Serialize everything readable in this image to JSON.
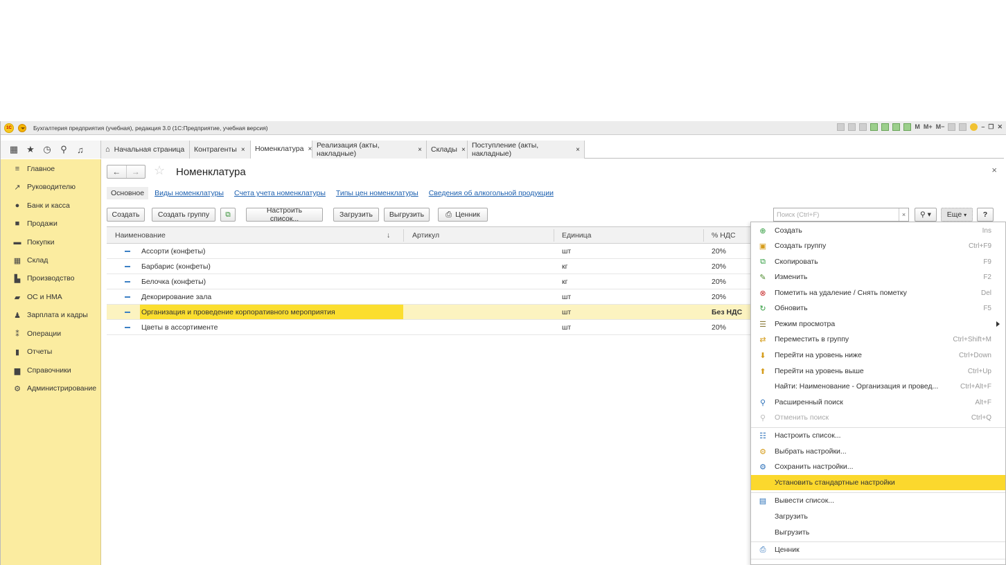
{
  "window": {
    "title": "Бухгалтерия предприятия (учебная), редакция 3.0  (1С:Предприятие, учебная версия)",
    "logo_text": "1С",
    "tool_labels": [
      "M",
      "M+",
      "M−"
    ]
  },
  "tabs": [
    {
      "label": "Начальная страница",
      "closable": false
    },
    {
      "label": "Контрагенты",
      "closable": true
    },
    {
      "label": "Номенклатура",
      "closable": true,
      "active": true
    },
    {
      "label": "Реализация (акты, накладные)",
      "closable": true
    },
    {
      "label": "Склады",
      "closable": true
    },
    {
      "label": "Поступление (акты, накладные)",
      "closable": true
    }
  ],
  "close_glyph": "×",
  "sidebar": {
    "items": [
      {
        "label": "Главное",
        "icon": "menu-icon"
      },
      {
        "label": "Руководителю",
        "icon": "trend-icon"
      },
      {
        "label": "Банк и касса",
        "icon": "coin-icon"
      },
      {
        "label": "Продажи",
        "icon": "bag-icon"
      },
      {
        "label": "Покупки",
        "icon": "cart-icon"
      },
      {
        "label": "Склад",
        "icon": "warehouse-icon"
      },
      {
        "label": "Производство",
        "icon": "factory-icon"
      },
      {
        "label": "ОС и НМА",
        "icon": "truck-icon"
      },
      {
        "label": "Зарплата и кадры",
        "icon": "person-icon"
      },
      {
        "label": "Операции",
        "icon": "operations-icon"
      },
      {
        "label": "Отчеты",
        "icon": "bar-chart-icon"
      },
      {
        "label": "Справочники",
        "icon": "book-icon"
      },
      {
        "label": "Администрирование",
        "icon": "gear-icon"
      }
    ]
  },
  "form": {
    "title": "Номенклатура",
    "subnav": [
      "Основное",
      "Виды номенклатуры",
      "Счета учета номенклатуры",
      "Типы цен номенклатуры",
      "Сведения об алкогольной продукции"
    ],
    "toolbar": {
      "create": "Создать",
      "create_group": "Создать группу",
      "configure_list": "Настроить список...",
      "load": "Загрузить",
      "unload": "Выгрузить",
      "price_tag": "Ценник",
      "more": "Еще",
      "help": "?"
    },
    "search": {
      "placeholder": "Поиск (Ctrl+F)",
      "value": ""
    }
  },
  "table": {
    "columns": [
      "Наименование",
      "Артикул",
      "Единица",
      "% НДС"
    ],
    "rows": [
      {
        "name": "Ассорти (конфеты)",
        "article": "",
        "unit": "шт",
        "vat": "20%"
      },
      {
        "name": "Барбарис (конфеты)",
        "article": "",
        "unit": "кг",
        "vat": "20%"
      },
      {
        "name": "Белочка (конфеты)",
        "article": "",
        "unit": "кг",
        "vat": "20%"
      },
      {
        "name": "Декорирование зала",
        "article": "",
        "unit": "шт",
        "vat": "20%"
      },
      {
        "name": "Организация и проведение корпоративного мероприятия",
        "article": "",
        "unit": "шт",
        "vat": "Без НДС",
        "selected": true
      },
      {
        "name": "Цветы в ассортименте",
        "article": "",
        "unit": "шт",
        "vat": "20%"
      }
    ]
  },
  "menu": {
    "items": [
      {
        "label": "Создать",
        "shortcut": "Ins",
        "icon": "plus-icon"
      },
      {
        "label": "Создать группу",
        "shortcut": "Ctrl+F9",
        "icon": "folder-add-icon"
      },
      {
        "label": "Скопировать",
        "shortcut": "F9",
        "icon": "copy-icon"
      },
      {
        "label": "Изменить",
        "shortcut": "F2",
        "icon": "pencil-icon"
      },
      {
        "label": "Пометить на удаление / Снять пометку",
        "shortcut": "Del",
        "icon": "delete-mark-icon"
      },
      {
        "label": "Обновить",
        "shortcut": "F5",
        "icon": "refresh-icon"
      },
      {
        "label": "Режим просмотра",
        "shortcut": "",
        "icon": "view-mode-icon"
      },
      {
        "label": "Переместить в группу",
        "shortcut": "Ctrl+Shift+M",
        "icon": "move-icon"
      },
      {
        "label": "Перейти на уровень ниже",
        "shortcut": "Ctrl+Down",
        "icon": "level-down-icon"
      },
      {
        "label": "Перейти на уровень выше",
        "shortcut": "Ctrl+Up",
        "icon": "level-up-icon"
      },
      {
        "label": "Найти: Наименование - Организация и провед...",
        "shortcut": "Ctrl+Alt+F",
        "icon": ""
      },
      {
        "label": "Расширенный поиск",
        "shortcut": "Alt+F",
        "icon": "search-icon"
      },
      {
        "label": "Отменить поиск",
        "shortcut": "Ctrl+Q",
        "icon": "cancel-search-icon"
      },
      {
        "label": "Настроить список...",
        "shortcut": "",
        "icon": "list-settings-icon"
      },
      {
        "label": "Выбрать настройки...",
        "shortcut": "",
        "icon": "choose-settings-icon"
      },
      {
        "label": "Сохранить настройки...",
        "shortcut": "",
        "icon": "save-settings-icon"
      },
      {
        "label": "Установить стандартные настройки",
        "shortcut": "",
        "icon": ""
      },
      {
        "label": "Вывести список...",
        "shortcut": "",
        "icon": "print-list-icon"
      },
      {
        "label": "Загрузить",
        "shortcut": "",
        "icon": ""
      },
      {
        "label": "Выгрузить",
        "shortcut": "",
        "icon": ""
      },
      {
        "label": "Ценник",
        "shortcut": "",
        "icon": "printer-icon"
      }
    ]
  },
  "colors": {
    "sidebar": "#fbeca0",
    "selection": "#fbde2f",
    "menu_highlight": "#fbd82d",
    "link": "#1b5faf"
  }
}
